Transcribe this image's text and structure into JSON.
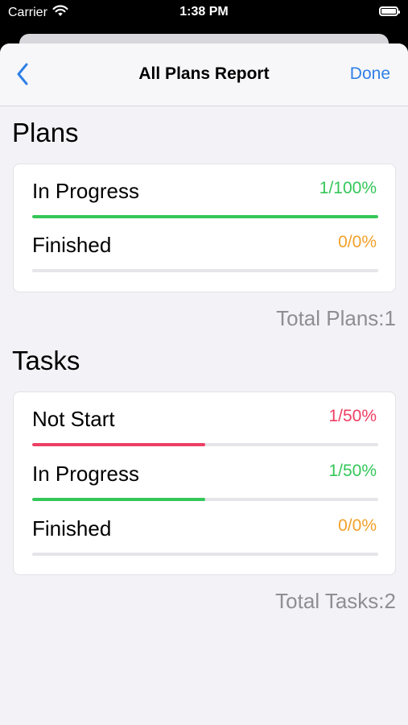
{
  "status_bar": {
    "carrier": "Carrier",
    "time": "1:38 PM"
  },
  "navbar": {
    "title": "All Plans Report",
    "done_label": "Done",
    "back_icon": "chevron-left-icon"
  },
  "colors": {
    "green": "#34c759",
    "orange": "#f2a02a",
    "red": "#ee3f63",
    "blue": "#2f80e6",
    "track": "#e5e5ea"
  },
  "plans": {
    "title": "Plans",
    "rows": [
      {
        "label": "In Progress",
        "value": "1/100%",
        "progress": 1.0,
        "color": "#34c759"
      },
      {
        "label": "Finished",
        "value": "0/0%",
        "progress": 0.0,
        "color": "#f2a02a"
      }
    ],
    "total": "Total Plans:1"
  },
  "tasks": {
    "title": "Tasks",
    "rows": [
      {
        "label": "Not Start",
        "value": "1/50%",
        "progress": 0.5,
        "color": "#ee3f63"
      },
      {
        "label": "In Progress",
        "value": "1/50%",
        "progress": 0.5,
        "color": "#34c759"
      },
      {
        "label": "Finished",
        "value": "0/0%",
        "progress": 0.0,
        "color": "#f2a02a"
      }
    ],
    "total": "Total Tasks:2"
  }
}
